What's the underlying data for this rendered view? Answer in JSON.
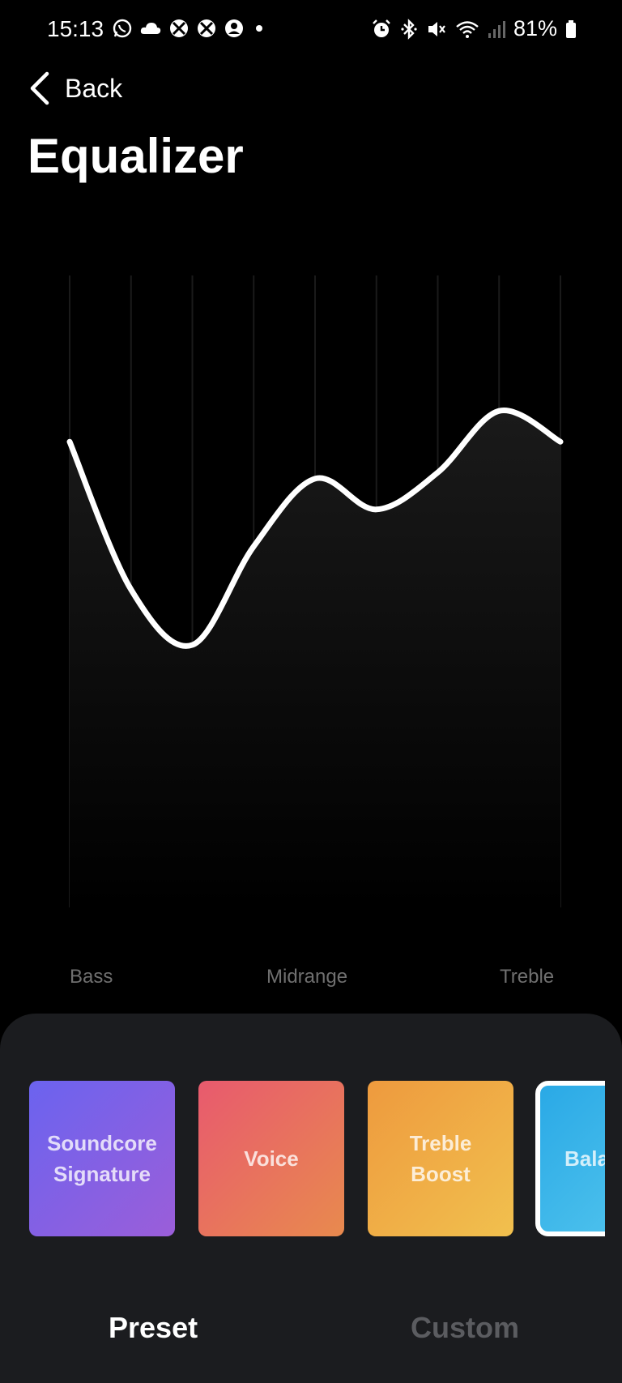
{
  "status_bar": {
    "time": "15:13",
    "battery": "81%",
    "left_icons": [
      "whatsapp-icon",
      "cloud-icon",
      "xbox-icon",
      "xbox-icon",
      "account-icon",
      "dot-icon"
    ],
    "right_icons": [
      "alarm-icon",
      "bluetooth-icon",
      "mute-icon",
      "wifi-icon",
      "signal-icon",
      "battery-icon"
    ]
  },
  "header": {
    "back_label": "Back",
    "title": "Equalizer"
  },
  "equalizer": {
    "band_labels": {
      "bass": "Bass",
      "midrange": "Midrange",
      "treble": "Treble"
    },
    "band_count": 9,
    "band_levels": [
      0.73,
      0.49,
      0.4,
      0.56,
      0.67,
      0.62,
      0.68,
      0.78,
      0.73
    ],
    "line_color": "#ffffff",
    "grid_color": "#1a1a1a"
  },
  "presets": [
    {
      "lines": [
        "Soundcore",
        "Signature"
      ],
      "color_from": "#6b63ef",
      "color_to": "#9b5ed9",
      "selected": false
    },
    {
      "lines": [
        "Voice"
      ],
      "color_from": "#e85a6e",
      "color_to": "#e88a4e",
      "selected": false
    },
    {
      "lines": [
        "Treble",
        "Boost"
      ],
      "color_from": "#ee9a3e",
      "color_to": "#f1c04e",
      "selected": false
    },
    {
      "lines": [
        "Bala"
      ],
      "color_from": "#2aa9e6",
      "color_to": "#55c7ee",
      "selected": true
    }
  ],
  "tabs": {
    "preset": "Preset",
    "custom": "Custom",
    "active": "preset"
  }
}
